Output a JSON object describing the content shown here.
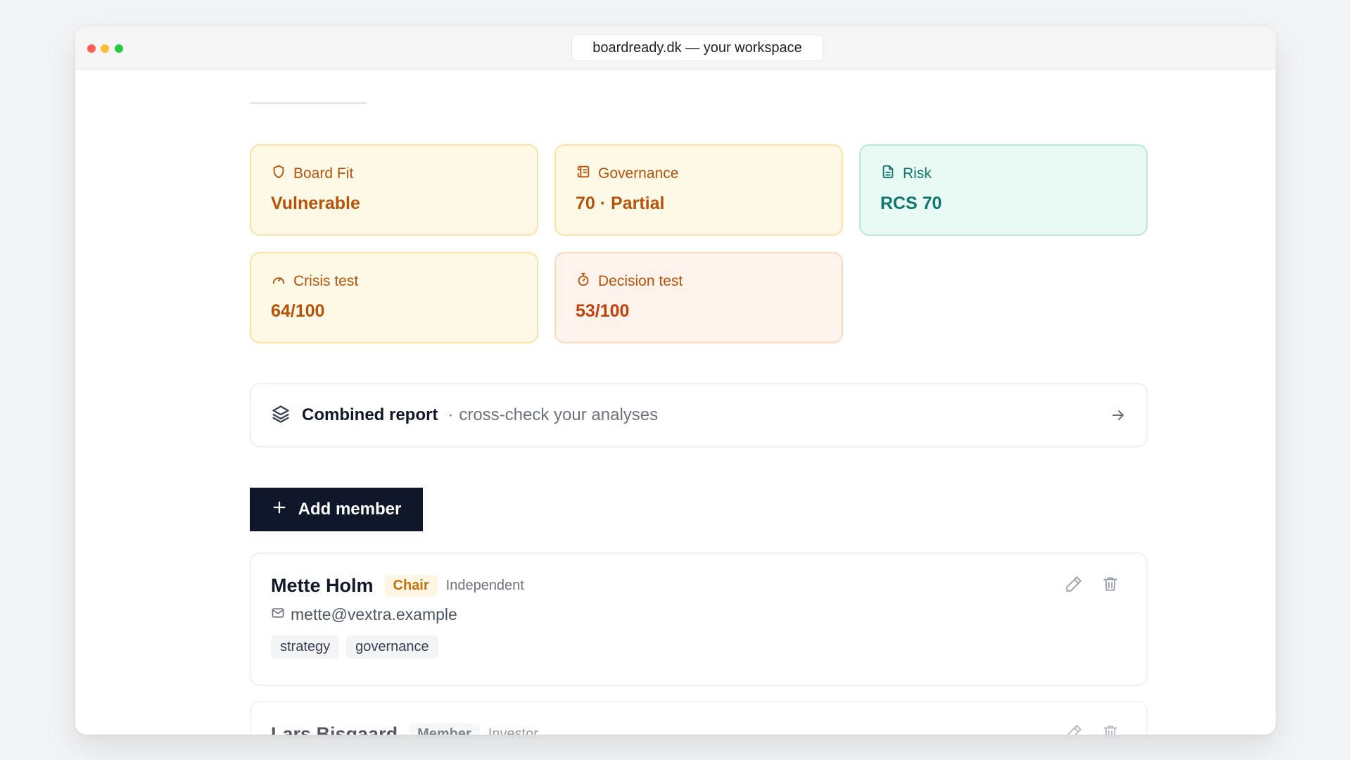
{
  "browser": {
    "url_title": "boardready.dk — your workspace"
  },
  "stats": [
    {
      "label": "Board Fit",
      "value": "Vulnerable",
      "icon": "shield-icon",
      "tone": "amber"
    },
    {
      "label": "Governance",
      "value": "70 · Partial",
      "icon": "scroll-icon",
      "tone": "amber"
    },
    {
      "label": "Risk",
      "value": "RCS 70",
      "icon": "document-icon",
      "tone": "teal"
    },
    {
      "label": "Crisis test",
      "value": "64/100",
      "icon": "gauge-icon",
      "tone": "amber"
    },
    {
      "label": "Decision test",
      "value": "53/100",
      "icon": "stopwatch-icon",
      "tone": "orange"
    }
  ],
  "combined_report": {
    "title": "Combined report",
    "separator": "·",
    "subtitle": "cross-check your analyses",
    "icon": "layers-icon"
  },
  "add_member": {
    "label": "Add member",
    "icon": "plus-icon"
  },
  "members": [
    {
      "name": "Mette Holm",
      "role": "Chair",
      "type": "Independent",
      "email": "mette@vextra.example",
      "tags": [
        "strategy",
        "governance"
      ]
    },
    {
      "name": "Lars Bisgaard",
      "role": "Member",
      "type": "Investor"
    }
  ],
  "colors": {
    "amber_bg": "#fef9e7",
    "amber_text": "#b45309",
    "orange_bg": "#fdf3ea",
    "teal_bg": "#e8faf3",
    "teal_text": "#0f766e",
    "primary_button": "#0f172a"
  }
}
